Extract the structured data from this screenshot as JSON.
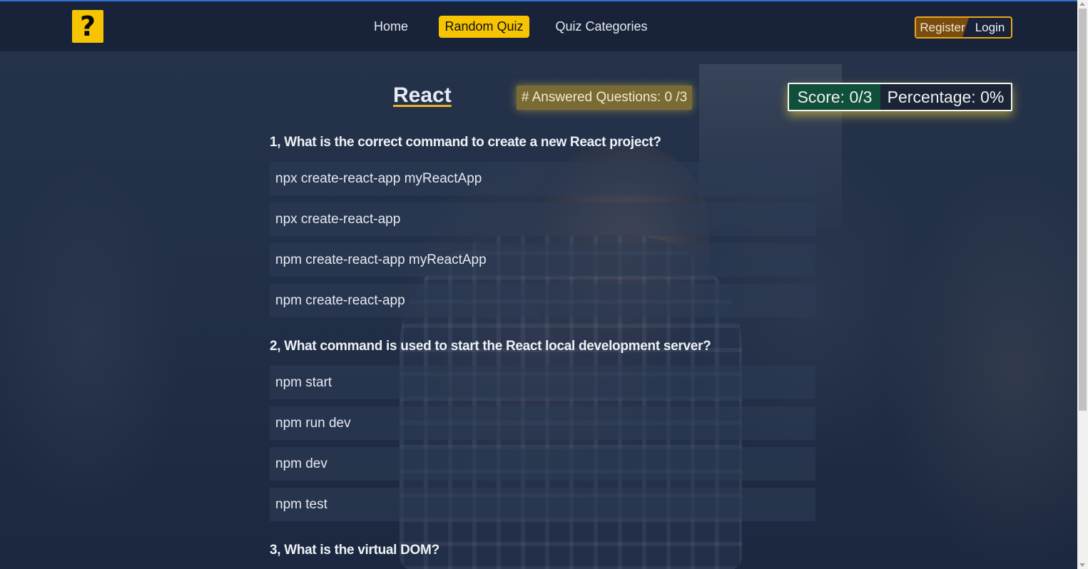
{
  "nav": {
    "logo_glyph": "?",
    "links": [
      "Home",
      "Random Quiz",
      "Quiz Categories"
    ],
    "active": "Random Quiz",
    "register": "Register",
    "login": "Login"
  },
  "quiz": {
    "title": "React",
    "answered": "# Answered Questions: 0 /3",
    "score": "Score: 0/3",
    "percentage": "Percentage: 0%"
  },
  "questions": [
    {
      "text": "1, What is the correct command to create a new React project?",
      "options": [
        "npx create-react-app myReactApp",
        "npx create-react-app",
        "npm create-react-app myReactApp",
        "npm create-react-app"
      ]
    },
    {
      "text": "2, What command is used to start the React local development server?",
      "options": [
        "npm start",
        "npm run dev",
        "npm dev",
        "npm test"
      ]
    },
    {
      "text": "3, What is the virtual DOM?",
      "options": []
    }
  ],
  "colors": {
    "accent": "#f6c400",
    "navbar": "#18233a",
    "score_bg": "#10503a"
  }
}
